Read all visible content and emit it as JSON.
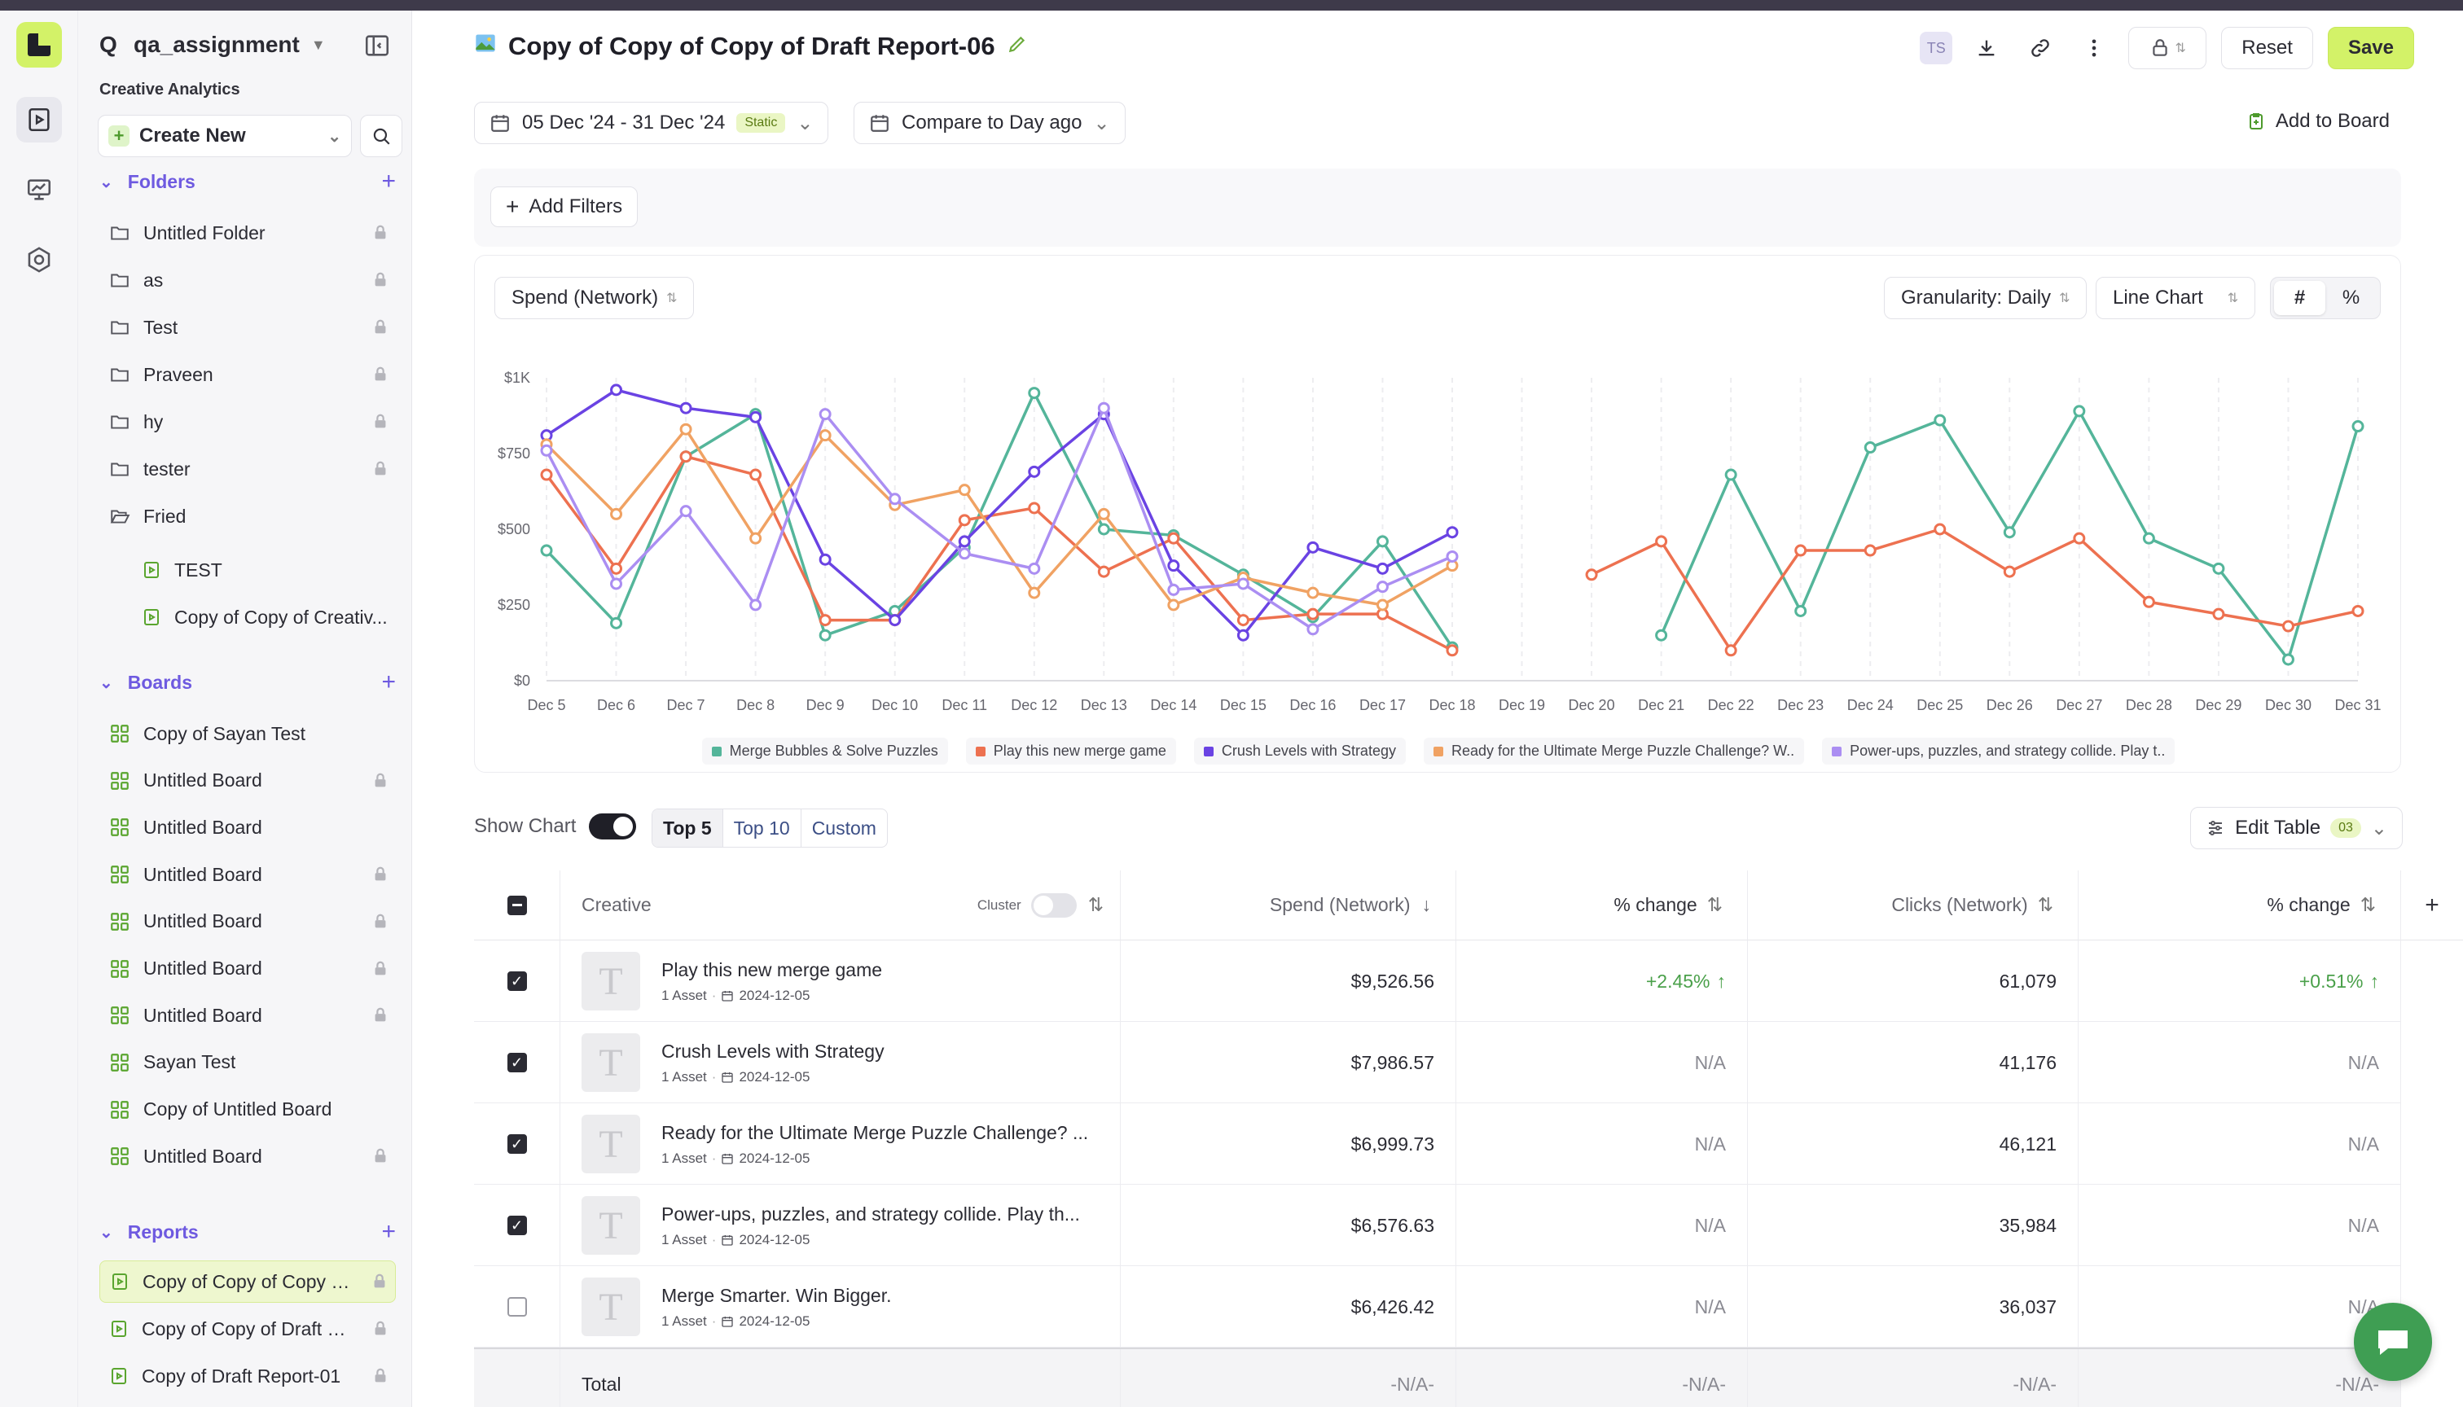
{
  "workspace": {
    "name": "qa_assignment",
    "q": "Q"
  },
  "sidebar": {
    "section_label": "Creative Analytics",
    "create_new": "Create New",
    "folders_label": "Folders",
    "folders": [
      "Untitled Folder",
      "as",
      "Test",
      "Praveen",
      "hy",
      "tester",
      "Fried"
    ],
    "folder_children": [
      "TEST",
      "Copy of Copy of Creativ..."
    ],
    "boards_label": "Boards",
    "boards": [
      "Copy of Sayan Test",
      "Untitled Board",
      "Untitled Board",
      "Untitled Board",
      "Untitled Board",
      "Untitled Board",
      "Untitled Board",
      "Sayan Test",
      "Copy of Untitled Board",
      "Untitled Board"
    ],
    "reports_label": "Reports",
    "reports": [
      "Copy of Copy of Copy of...",
      "Copy of Copy of Draft Re...",
      "Copy of Draft Report-01"
    ]
  },
  "header": {
    "title": "Copy of Copy of Copy of Draft Report-06",
    "avatar": "TS",
    "reset": "Reset",
    "save": "Save"
  },
  "toolbar": {
    "date_range": "05 Dec '24 - 31 Dec '24",
    "static_badge": "Static",
    "compare": "Compare to Day ago",
    "add_to_board": "Add to Board",
    "add_filters": "Add Filters"
  },
  "chart_controls": {
    "metric": "Spend (Network)",
    "granularity": "Granularity: Daily",
    "chart_type": "Line Chart",
    "hash": "#",
    "percent": "%"
  },
  "chart_data": {
    "type": "line",
    "x": [
      "Dec 5",
      "Dec 6",
      "Dec 7",
      "Dec 8",
      "Dec 9",
      "Dec 10",
      "Dec 11",
      "Dec 12",
      "Dec 13",
      "Dec 14",
      "Dec 15",
      "Dec 16",
      "Dec 17",
      "Dec 18",
      "Dec 19",
      "Dec 20",
      "Dec 21",
      "Dec 22",
      "Dec 23",
      "Dec 24",
      "Dec 25",
      "Dec 26",
      "Dec 27",
      "Dec 28",
      "Dec 29",
      "Dec 30",
      "Dec 31"
    ],
    "yticks": [
      "$0",
      "$250",
      "$500",
      "$750",
      "$1K"
    ],
    "ylim": [
      0,
      1000
    ],
    "series": [
      {
        "name": "Merge Bubbles & Solve Puzzles",
        "color": "#54b59a",
        "values": [
          430,
          190,
          740,
          880,
          150,
          230,
          440,
          950,
          500,
          480,
          350,
          210,
          460,
          110,
          null,
          null,
          150,
          680,
          230,
          770,
          860,
          490,
          890,
          470,
          370,
          70,
          840
        ]
      },
      {
        "name": "Play this new merge game",
        "color": "#ed7150",
        "values": [
          680,
          370,
          740,
          680,
          200,
          200,
          530,
          570,
          360,
          470,
          200,
          220,
          220,
          100,
          null,
          350,
          460,
          100,
          430,
          430,
          500,
          360,
          470,
          260,
          220,
          180,
          230
        ]
      },
      {
        "name": "Crush Levels with Strategy",
        "color": "#6a43e3",
        "values": [
          810,
          960,
          900,
          870,
          400,
          200,
          460,
          690,
          880,
          380,
          150,
          440,
          370,
          490,
          null,
          null,
          null,
          null,
          null,
          null,
          null,
          null,
          null,
          null,
          null,
          null,
          null
        ]
      },
      {
        "name": "Ready for the Ultimate Merge Puzzle Challenge? W..",
        "color": "#f0a263",
        "values": [
          780,
          550,
          830,
          470,
          810,
          580,
          630,
          290,
          550,
          250,
          340,
          290,
          250,
          380,
          null,
          null,
          null,
          null,
          null,
          null,
          null,
          null,
          null,
          null,
          null,
          null,
          null
        ]
      },
      {
        "name": "Power-ups, puzzles, and strategy collide. Play t..",
        "color": "#ab8ef2",
        "values": [
          760,
          320,
          560,
          250,
          880,
          600,
          420,
          370,
          900,
          300,
          320,
          170,
          310,
          410,
          null,
          null,
          null,
          null,
          null,
          null,
          null,
          null,
          null,
          null,
          null,
          null,
          null
        ]
      }
    ]
  },
  "table_controls": {
    "show_chart": "Show Chart",
    "top5": "Top 5",
    "top10": "Top 10",
    "custom": "Custom",
    "edit_table": "Edit Table",
    "count": "03"
  },
  "table": {
    "headers": {
      "creative": "Creative",
      "cluster": "Cluster",
      "spend": "Spend (Network)",
      "change1": "% change",
      "clicks": "Clicks (Network)",
      "change2": "% change"
    },
    "rows": [
      {
        "name": "Play this new merge game",
        "assets": "1 Asset",
        "date": "2024-12-05",
        "spend": "$9,526.56",
        "change1": "+2.45%",
        "clicks": "61,079",
        "change2": "+0.51%",
        "checked": true
      },
      {
        "name": "Crush Levels with Strategy",
        "assets": "1 Asset",
        "date": "2024-12-05",
        "spend": "$7,986.57",
        "change1": "N/A",
        "clicks": "41,176",
        "change2": "N/A",
        "checked": true
      },
      {
        "name": "Ready for the Ultimate Merge Puzzle Challenge? ...",
        "assets": "1 Asset",
        "date": "2024-12-05",
        "spend": "$6,999.73",
        "change1": "N/A",
        "clicks": "46,121",
        "change2": "N/A",
        "checked": true
      },
      {
        "name": "Power-ups, puzzles, and strategy collide. Play th...",
        "assets": "1 Asset",
        "date": "2024-12-05",
        "spend": "$6,576.63",
        "change1": "N/A",
        "clicks": "35,984",
        "change2": "N/A",
        "checked": true
      },
      {
        "name": "Merge Smarter. Win Bigger.",
        "assets": "1 Asset",
        "date": "2024-12-05",
        "spend": "$6,426.42",
        "change1": "N/A",
        "clicks": "36,037",
        "change2": "N/A",
        "checked": false
      }
    ],
    "total": {
      "label": "Total",
      "spend": "-N/A-",
      "change1": "-N/A-",
      "clicks": "-N/A-",
      "change2": "-N/A-"
    },
    "thumb_letter": "T"
  },
  "colors": {
    "accent": "#d3f268",
    "brand_purple": "#6e5ae0",
    "positive": "#4aa04a"
  }
}
